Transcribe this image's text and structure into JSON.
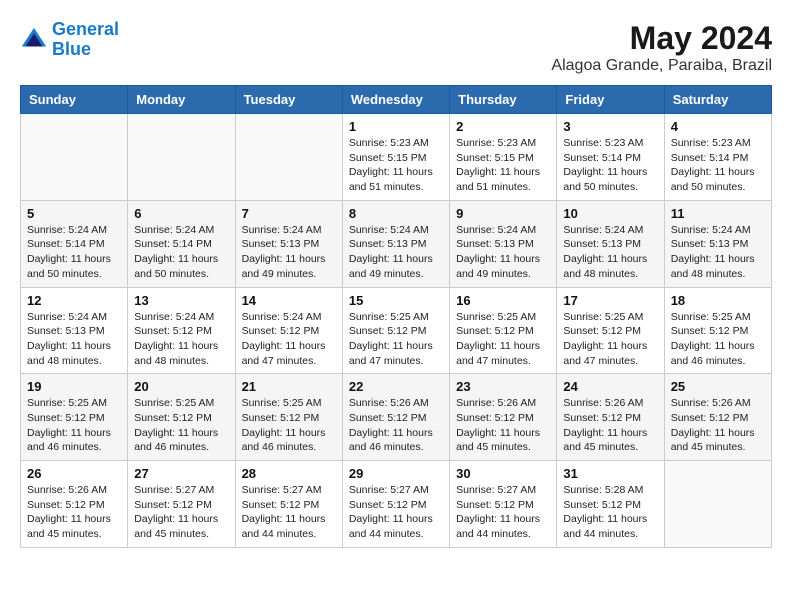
{
  "logo": {
    "line1": "General",
    "line2": "Blue"
  },
  "title": "May 2024",
  "location": "Alagoa Grande, Paraiba, Brazil",
  "weekdays": [
    "Sunday",
    "Monday",
    "Tuesday",
    "Wednesday",
    "Thursday",
    "Friday",
    "Saturday"
  ],
  "weeks": [
    [
      {
        "day": "",
        "info": ""
      },
      {
        "day": "",
        "info": ""
      },
      {
        "day": "",
        "info": ""
      },
      {
        "day": "1",
        "info": "Sunrise: 5:23 AM\nSunset: 5:15 PM\nDaylight: 11 hours\nand 51 minutes."
      },
      {
        "day": "2",
        "info": "Sunrise: 5:23 AM\nSunset: 5:15 PM\nDaylight: 11 hours\nand 51 minutes."
      },
      {
        "day": "3",
        "info": "Sunrise: 5:23 AM\nSunset: 5:14 PM\nDaylight: 11 hours\nand 50 minutes."
      },
      {
        "day": "4",
        "info": "Sunrise: 5:23 AM\nSunset: 5:14 PM\nDaylight: 11 hours\nand 50 minutes."
      }
    ],
    [
      {
        "day": "5",
        "info": "Sunrise: 5:24 AM\nSunset: 5:14 PM\nDaylight: 11 hours\nand 50 minutes."
      },
      {
        "day": "6",
        "info": "Sunrise: 5:24 AM\nSunset: 5:14 PM\nDaylight: 11 hours\nand 50 minutes."
      },
      {
        "day": "7",
        "info": "Sunrise: 5:24 AM\nSunset: 5:13 PM\nDaylight: 11 hours\nand 49 minutes."
      },
      {
        "day": "8",
        "info": "Sunrise: 5:24 AM\nSunset: 5:13 PM\nDaylight: 11 hours\nand 49 minutes."
      },
      {
        "day": "9",
        "info": "Sunrise: 5:24 AM\nSunset: 5:13 PM\nDaylight: 11 hours\nand 49 minutes."
      },
      {
        "day": "10",
        "info": "Sunrise: 5:24 AM\nSunset: 5:13 PM\nDaylight: 11 hours\nand 48 minutes."
      },
      {
        "day": "11",
        "info": "Sunrise: 5:24 AM\nSunset: 5:13 PM\nDaylight: 11 hours\nand 48 minutes."
      }
    ],
    [
      {
        "day": "12",
        "info": "Sunrise: 5:24 AM\nSunset: 5:13 PM\nDaylight: 11 hours\nand 48 minutes."
      },
      {
        "day": "13",
        "info": "Sunrise: 5:24 AM\nSunset: 5:12 PM\nDaylight: 11 hours\nand 48 minutes."
      },
      {
        "day": "14",
        "info": "Sunrise: 5:24 AM\nSunset: 5:12 PM\nDaylight: 11 hours\nand 47 minutes."
      },
      {
        "day": "15",
        "info": "Sunrise: 5:25 AM\nSunset: 5:12 PM\nDaylight: 11 hours\nand 47 minutes."
      },
      {
        "day": "16",
        "info": "Sunrise: 5:25 AM\nSunset: 5:12 PM\nDaylight: 11 hours\nand 47 minutes."
      },
      {
        "day": "17",
        "info": "Sunrise: 5:25 AM\nSunset: 5:12 PM\nDaylight: 11 hours\nand 47 minutes."
      },
      {
        "day": "18",
        "info": "Sunrise: 5:25 AM\nSunset: 5:12 PM\nDaylight: 11 hours\nand 46 minutes."
      }
    ],
    [
      {
        "day": "19",
        "info": "Sunrise: 5:25 AM\nSunset: 5:12 PM\nDaylight: 11 hours\nand 46 minutes."
      },
      {
        "day": "20",
        "info": "Sunrise: 5:25 AM\nSunset: 5:12 PM\nDaylight: 11 hours\nand 46 minutes."
      },
      {
        "day": "21",
        "info": "Sunrise: 5:25 AM\nSunset: 5:12 PM\nDaylight: 11 hours\nand 46 minutes."
      },
      {
        "day": "22",
        "info": "Sunrise: 5:26 AM\nSunset: 5:12 PM\nDaylight: 11 hours\nand 46 minutes."
      },
      {
        "day": "23",
        "info": "Sunrise: 5:26 AM\nSunset: 5:12 PM\nDaylight: 11 hours\nand 45 minutes."
      },
      {
        "day": "24",
        "info": "Sunrise: 5:26 AM\nSunset: 5:12 PM\nDaylight: 11 hours\nand 45 minutes."
      },
      {
        "day": "25",
        "info": "Sunrise: 5:26 AM\nSunset: 5:12 PM\nDaylight: 11 hours\nand 45 minutes."
      }
    ],
    [
      {
        "day": "26",
        "info": "Sunrise: 5:26 AM\nSunset: 5:12 PM\nDaylight: 11 hours\nand 45 minutes."
      },
      {
        "day": "27",
        "info": "Sunrise: 5:27 AM\nSunset: 5:12 PM\nDaylight: 11 hours\nand 45 minutes."
      },
      {
        "day": "28",
        "info": "Sunrise: 5:27 AM\nSunset: 5:12 PM\nDaylight: 11 hours\nand 44 minutes."
      },
      {
        "day": "29",
        "info": "Sunrise: 5:27 AM\nSunset: 5:12 PM\nDaylight: 11 hours\nand 44 minutes."
      },
      {
        "day": "30",
        "info": "Sunrise: 5:27 AM\nSunset: 5:12 PM\nDaylight: 11 hours\nand 44 minutes."
      },
      {
        "day": "31",
        "info": "Sunrise: 5:28 AM\nSunset: 5:12 PM\nDaylight: 11 hours\nand 44 minutes."
      },
      {
        "day": "",
        "info": ""
      }
    ]
  ]
}
